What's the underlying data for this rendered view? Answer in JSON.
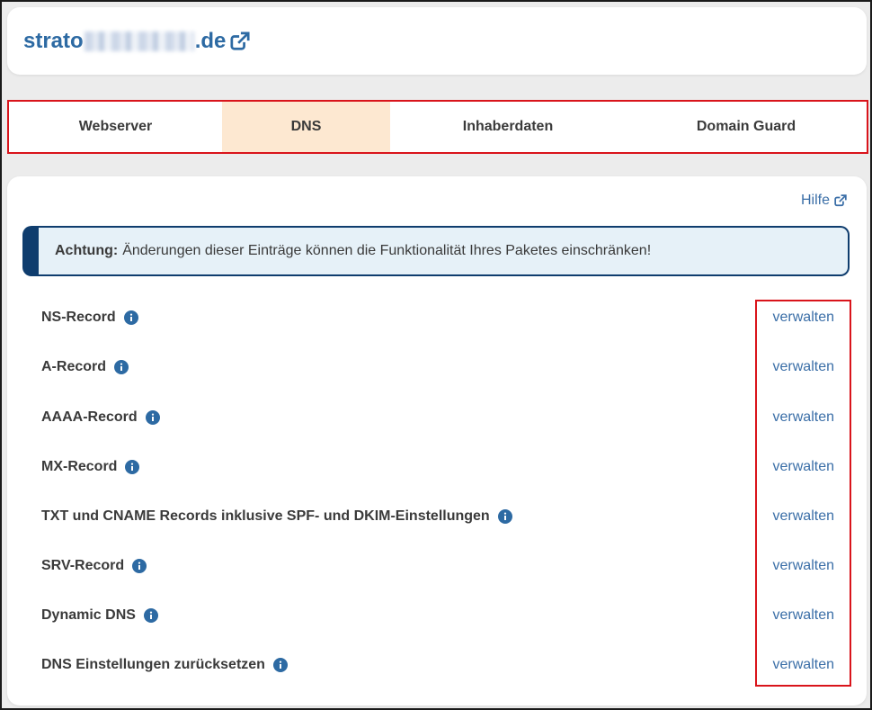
{
  "header": {
    "domain_prefix": "strato",
    "domain_suffix": ".de"
  },
  "tabs": [
    {
      "label": "Webserver",
      "active": false
    },
    {
      "label": "DNS",
      "active": true
    },
    {
      "label": "Inhaberdaten",
      "active": false
    },
    {
      "label": "Domain Guard",
      "active": false
    }
  ],
  "help": {
    "label": "Hilfe"
  },
  "alert": {
    "title": "Achtung:",
    "text": "Änderungen dieser Einträge können die Funktionalität Ihres Paketes einschränken!"
  },
  "records": [
    {
      "label": "NS-Record",
      "action": "verwalten"
    },
    {
      "label": "A-Record",
      "action": "verwalten"
    },
    {
      "label": "AAAA-Record",
      "action": "verwalten"
    },
    {
      "label": "MX-Record",
      "action": "verwalten"
    },
    {
      "label": "TXT und CNAME Records inklusive SPF- und DKIM-Einstellungen",
      "action": "verwalten"
    },
    {
      "label": "SRV-Record",
      "action": "verwalten"
    },
    {
      "label": "Dynamic DNS",
      "action": "verwalten"
    },
    {
      "label": "DNS Einstellungen zurücksetzen",
      "action": "verwalten"
    }
  ],
  "colors": {
    "link": "#3a6ea7",
    "domain": "#2d6aa3",
    "active_tab": "#fde8d1",
    "alert_bg": "#e6f1f8",
    "alert_border": "#0f3d6e",
    "highlight": "#d9141b"
  }
}
